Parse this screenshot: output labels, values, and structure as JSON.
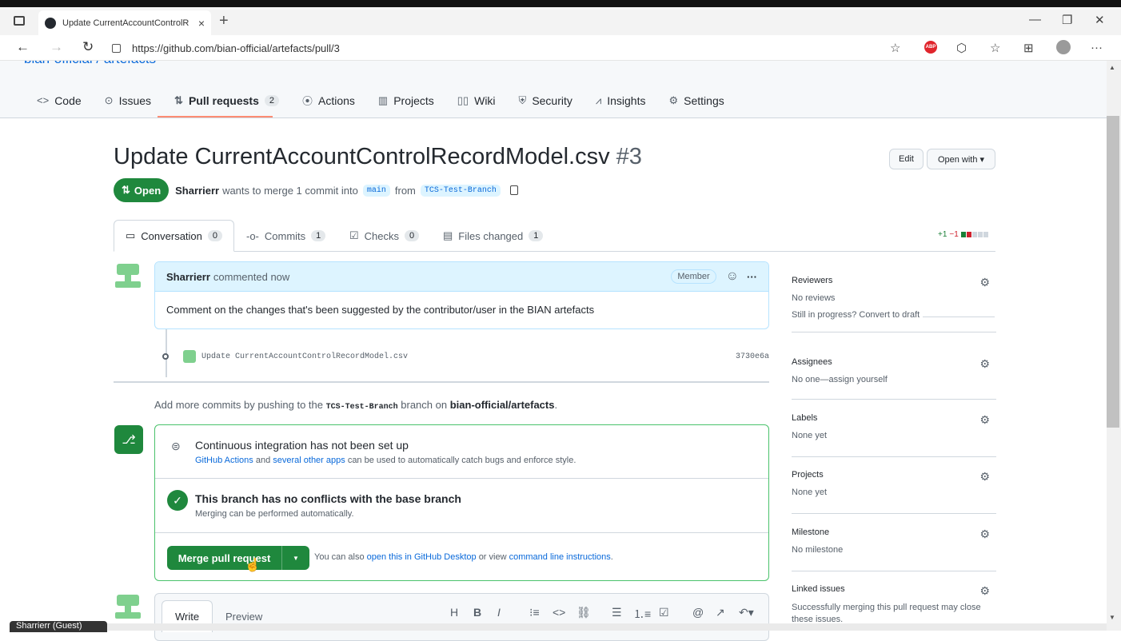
{
  "browser": {
    "tab_title": "Update CurrentAccountControlR",
    "url": "https://github.com/bian-official/artefacts/pull/3",
    "new_tab": "+",
    "tab_close": "×",
    "minimize": "—",
    "maximize": "❐",
    "close": "✕",
    "back": "←",
    "forward": "→",
    "refresh": "↻",
    "more": "···",
    "adp": "ABP"
  },
  "repo": {
    "title": "bian-official / artefacts",
    "nav": [
      {
        "label": "Code",
        "icon": "<>"
      },
      {
        "label": "Issues",
        "icon": "⊙"
      },
      {
        "label": "Pull requests",
        "icon": "⇅",
        "count": "2"
      },
      {
        "label": "Actions",
        "icon": "⦿"
      },
      {
        "label": "Projects",
        "icon": "▥"
      },
      {
        "label": "Wiki",
        "icon": "▯▯"
      },
      {
        "label": "Security",
        "icon": "⛨"
      },
      {
        "label": "Insights",
        "icon": "⩘"
      },
      {
        "label": "Settings",
        "icon": "⚙"
      }
    ]
  },
  "pr": {
    "title": "Update CurrentAccountControlRecordModel.csv",
    "number": "#3",
    "edit_label": "Edit",
    "open_with_label": "Open with ▾",
    "state": "Open",
    "author": "Sharrierr",
    "merge_text": "wants to merge 1 commit into",
    "base_branch": "main",
    "from_text": "from",
    "head_branch": "TCS-Test-Branch",
    "tabs": [
      {
        "label": "Conversation",
        "count": "0",
        "icon": "▭"
      },
      {
        "label": "Commits",
        "count": "1",
        "icon": "-o-"
      },
      {
        "label": "Checks",
        "count": "0",
        "icon": "☑"
      },
      {
        "label": "Files changed",
        "count": "1",
        "icon": "▤"
      }
    ],
    "additions": "+1",
    "deletions": "−1"
  },
  "comment": {
    "author": "Sharrierr",
    "meta": "commented now",
    "role": "Member",
    "body": "Comment on the changes that's been suggested by the contributor/user in the BIAN artefacts",
    "emoji_icon": "☺",
    "menu_icon": "···"
  },
  "commit": {
    "message": "Update CurrentAccountControlRecordModel.csv",
    "sha": "3730e6a"
  },
  "push_note": {
    "prefix": "Add more commits by pushing to the",
    "branch": "TCS-Test-Branch",
    "middle": "branch on",
    "repo": "bian-official/artefacts",
    "suffix": "."
  },
  "merge": {
    "ci_title": "Continuous integration has not been set up",
    "ci_link1": "GitHub Actions",
    "ci_and": "and",
    "ci_link2": "several other apps",
    "ci_suffix": "can be used to automatically catch bugs and enforce style.",
    "conflict_title": "This branch has no conflicts with the base branch",
    "conflict_sub": "Merging can be performed automatically.",
    "button_label": "Merge pull request",
    "also_prefix": "You can also",
    "also_link1": "open this in GitHub Desktop",
    "also_mid": "or view",
    "also_link2": "command line instructions",
    "also_suffix": "."
  },
  "composer": {
    "write": "Write",
    "preview": "Preview",
    "tools": [
      "H",
      "B",
      "I",
      "⁝≡",
      "<>",
      "⛓",
      "☰",
      "⒈≡",
      "☑",
      "@",
      "↗",
      "↶▾"
    ]
  },
  "sidebar": {
    "reviewers": {
      "label": "Reviewers",
      "value": "No reviews",
      "extra": "Still in progress? Convert to draft"
    },
    "assignees": {
      "label": "Assignees",
      "value": "No one—assign yourself"
    },
    "labels": {
      "label": "Labels",
      "value": "None yet"
    },
    "projects": {
      "label": "Projects",
      "value": "None yet"
    },
    "milestone": {
      "label": "Milestone",
      "value": "No milestone"
    },
    "linked": {
      "label": "Linked issues",
      "value": "Successfully merging this pull request may close these issues."
    }
  },
  "guest_label": "Sharrierr (Guest)",
  "colors": {
    "accent_green": "#1f883d",
    "link_blue": "#0969da",
    "tab_underline": "#fd8c73"
  }
}
